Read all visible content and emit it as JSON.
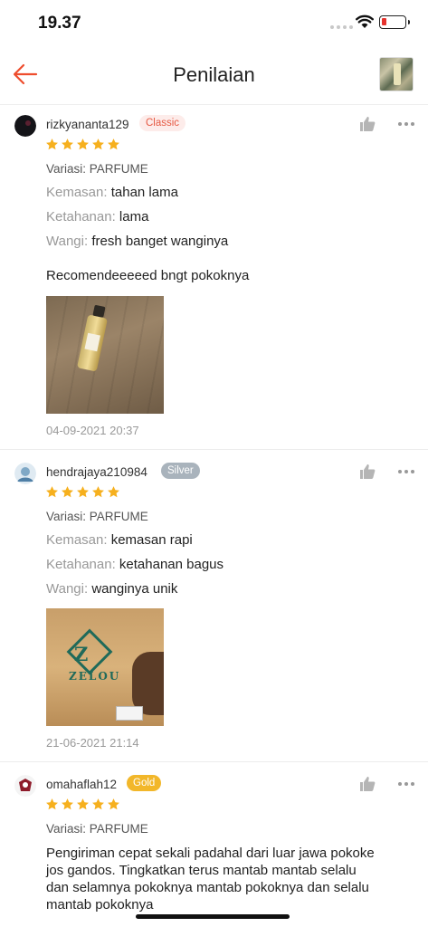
{
  "status_bar": {
    "time": "19.37"
  },
  "header": {
    "title": "Penilaian"
  },
  "colors": {
    "accent": "#ee4d2d",
    "star": "#f6b01e",
    "label_muted": "#999999"
  },
  "reviews": [
    {
      "username": "rizkyananta129",
      "tier": "Classic",
      "rating": 5,
      "variation": "Variasi: PARFUME",
      "attributes": [
        {
          "key": "Kemasan:",
          "value": "tahan lama"
        },
        {
          "key": "Ketahanan:",
          "value": "lama"
        },
        {
          "key": "Wangi:",
          "value": "fresh banget wanginya"
        }
      ],
      "comment": "Recomendeeeeed bngt pokoknya",
      "date": "04-09-2021 20:37"
    },
    {
      "username": "hendrajaya210984",
      "tier": "Silver",
      "rating": 5,
      "variation": "Variasi: PARFUME",
      "attributes": [
        {
          "key": "Kemasan:",
          "value": "kemasan rapi"
        },
        {
          "key": "Ketahanan:",
          "value": "ketahanan bagus"
        },
        {
          "key": "Wangi:",
          "value": "wanginya unik"
        }
      ],
      "photo_text": {
        "brand": "ZELOU",
        "mark": "Z"
      },
      "date": "21-06-2021 21:14"
    },
    {
      "username": "omahaflah12",
      "tier": "Gold",
      "rating": 5,
      "variation": "Variasi: PARFUME",
      "comment_lines": [
        "Pengiriman cepat sekali padahal dari luar jawa pokoke",
        "jos gandos. Tingkatkan terus mantab mantab selalu",
        "dan selamnya pokoknya mantab pokoknya dan selalu",
        "mantab pokoknya"
      ]
    }
  ]
}
